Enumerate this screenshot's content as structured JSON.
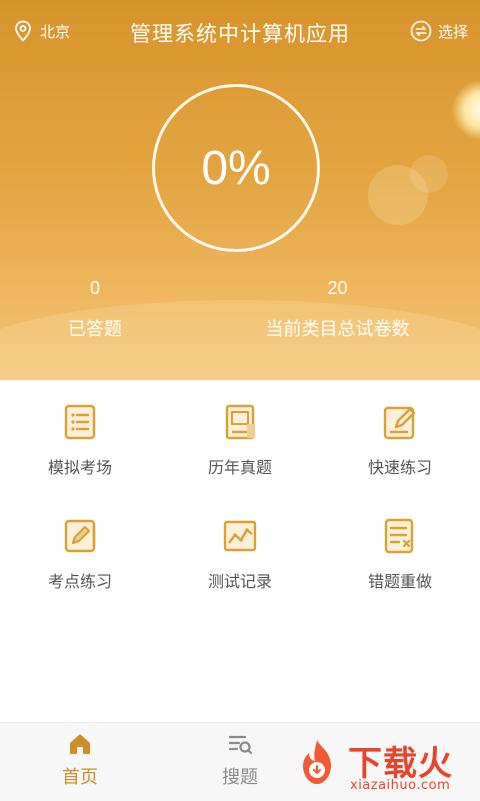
{
  "header": {
    "location": "北京",
    "title": "管理系统中计算机应用",
    "choose_label": "选择"
  },
  "progress": {
    "percent_text": "0%",
    "answered_count": "0",
    "answered_label": "已答题",
    "total_count": "20",
    "total_label": "当前类目总试卷数"
  },
  "menu": {
    "items": [
      {
        "label": "模拟考场",
        "icon": "list-doc-icon"
      },
      {
        "label": "历年真题",
        "icon": "book-icon"
      },
      {
        "label": "快速练习",
        "icon": "edit-icon"
      },
      {
        "label": "考点练习",
        "icon": "notebook-pen-icon"
      },
      {
        "label": "测试记录",
        "icon": "chart-icon"
      },
      {
        "label": "错题重做",
        "icon": "wrong-doc-icon"
      }
    ]
  },
  "tabbar": {
    "items": [
      {
        "label": "首页",
        "icon": "home-icon",
        "active": true
      },
      {
        "label": "搜题",
        "icon": "search-list-icon",
        "active": false
      }
    ]
  },
  "watermark": {
    "text": "下载火",
    "url": "xiazaihuo.com"
  },
  "colors": {
    "accent": "#d08c2a",
    "hero_top": "#d8942c",
    "hero_bottom": "#f3c47a",
    "icon": "#d9a033",
    "watermark": "#e8442c"
  }
}
